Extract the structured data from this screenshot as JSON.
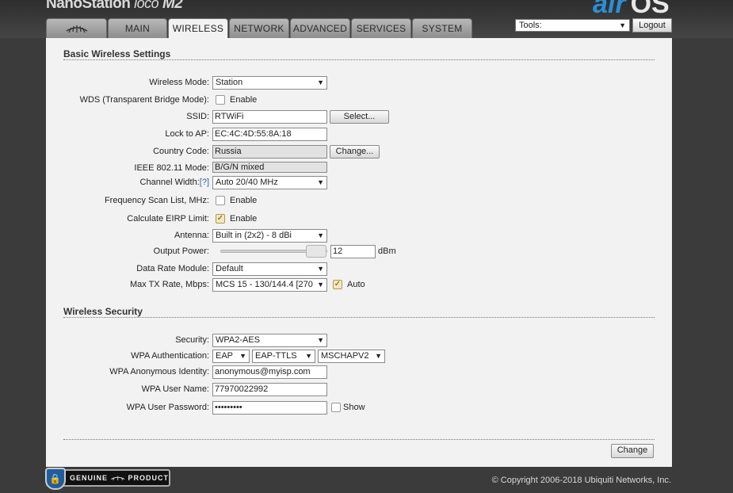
{
  "header": {
    "brand": {
      "name": "NanoStation",
      "variant": "loco",
      "model": "M2"
    },
    "airos": {
      "air": "air",
      "os": "OS"
    },
    "tabs": [
      {
        "label": "",
        "icon": "ubiquiti-logo-icon"
      },
      {
        "label": "MAIN"
      },
      {
        "label": "WIRELESS",
        "active": true
      },
      {
        "label": "NETWORK"
      },
      {
        "label": "ADVANCED"
      },
      {
        "label": "SERVICES"
      },
      {
        "label": "SYSTEM"
      }
    ],
    "tools": {
      "value": "Tools:"
    },
    "logout_label": "Logout"
  },
  "basic": {
    "title": "Basic Wireless Settings",
    "wireless_mode": {
      "label": "Wireless Mode:",
      "value": "Station"
    },
    "wds": {
      "label": "WDS (Transparent Bridge Mode):",
      "checkbox_label": "Enable",
      "checked": false
    },
    "ssid": {
      "label": "SSID:",
      "value": "RTWiFi",
      "button": "Select..."
    },
    "lock_ap": {
      "label": "Lock to AP:",
      "value": "EC:4C:4D:55:8A:18"
    },
    "country": {
      "label": "Country Code:",
      "value": "Russia",
      "button": "Change..."
    },
    "ieee": {
      "label": "IEEE 802.11 Mode:",
      "value": "B/G/N mixed"
    },
    "channel_width": {
      "label": "Channel Width:",
      "help": "[?]",
      "value": "Auto 20/40 MHz"
    },
    "freq_scan": {
      "label": "Frequency Scan List, MHz:",
      "checkbox_label": "Enable",
      "checked": false
    },
    "eirp": {
      "label": "Calculate EIRP Limit:",
      "checkbox_label": "Enable",
      "checked": true
    },
    "antenna": {
      "label": "Antenna:",
      "value": "Built in (2x2) - 8 dBi"
    },
    "output_power": {
      "label": "Output Power:",
      "value": "12",
      "unit": "dBm"
    },
    "data_rate_module": {
      "label": "Data Rate Module:",
      "value": "Default"
    },
    "max_tx_rate": {
      "label": "Max TX Rate, Mbps:",
      "value": "MCS 15 - 130/144.4 [270",
      "checkbox_label": "Auto",
      "checked": true
    }
  },
  "security": {
    "title": "Wireless Security",
    "security": {
      "label": "Security:",
      "value": "WPA2-AES"
    },
    "wpa_auth": {
      "label": "WPA Authentication:",
      "eap": "EAP",
      "method": "EAP-TTLS",
      "inner": "MSCHAPV2"
    },
    "anon_identity": {
      "label": "WPA Anonymous Identity:",
      "value": "anonymous@myisp.com"
    },
    "user_name": {
      "label": "WPA User Name:",
      "value": "77970022992"
    },
    "user_password": {
      "label": "WPA User Password:",
      "value": "•••••••••",
      "checkbox_label": "Show",
      "checked": false
    }
  },
  "change_label": "Change",
  "footer": {
    "genuine_left": "GENUINE",
    "genuine_right": "PRODUCT",
    "copyright": "© Copyright 2006-2018 Ubiquiti Networks, Inc."
  }
}
